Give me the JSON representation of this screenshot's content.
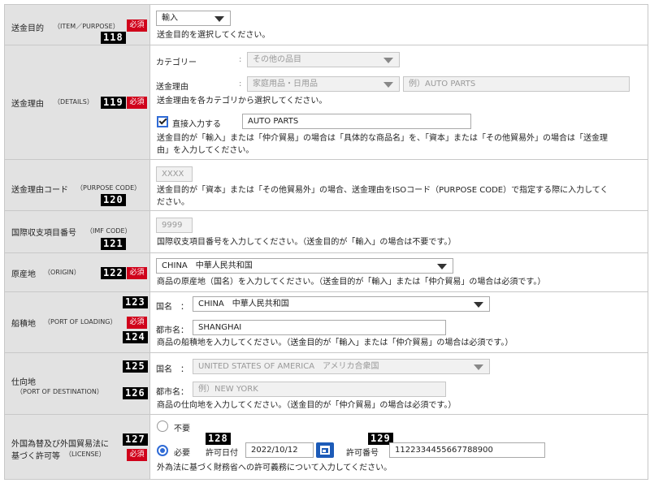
{
  "required_label": "必須",
  "rows": {
    "purpose": {
      "label": "送金目的",
      "label_en": "（ITEM／PURPOSE）",
      "number": "118",
      "value": "輸入",
      "help": "送金目的を選択してください。"
    },
    "details": {
      "label": "送金理由",
      "label_en": "（DETAILS）",
      "number": "119",
      "category_label": "カテゴリー",
      "category_value": "その他の品目",
      "reason_label": "送金理由",
      "reason_value": "家庭用品・日用品",
      "reason_placeholder": "例）AUTO PARTS",
      "help1": "送金理由を各カテゴリから選択してください。",
      "direct_label": "直接入力する",
      "direct_checked": true,
      "direct_value": "AUTO PARTS",
      "help2_line1": "送金目的が「輸入」または「仲介貿易」の場合は「具体的な商品名」を、「資本」または「その他貿易外」の場合は「送金理",
      "help2_line2": "由」を入力してください。"
    },
    "purpose_code": {
      "label": "送金理由コード",
      "label_en": "（PURPOSE CODE）",
      "number": "120",
      "placeholder": "XXXX",
      "help_line1": "送金目的が「資本」または「その他貿易外」の場合、送金理由をISOコード（PURPOSE CODE）で指定する際に入力してく",
      "help_line2": "ださい。"
    },
    "imf_code": {
      "label": "国際収支項目番号",
      "label_en": "（IMF CODE）",
      "number": "121",
      "placeholder": "9999",
      "help": "国際収支項目番号を入力してください。（送金目的が「輸入」の場合は不要です。）"
    },
    "origin": {
      "label": "原産地",
      "label_en": "（ORIGIN）",
      "number": "122",
      "value": "CHINA　中華人民共和国",
      "help": "商品の原産地（国名）を入力してください。（送金目的が「輸入」または「仲介貿易」の場合は必須です。）"
    },
    "loading": {
      "label": "船積地",
      "label_en": "（PORT OF LOADING）",
      "number_a": "123",
      "number_b": "124",
      "country_label": "国名　：",
      "country_value": "CHINA　中華人民共和国",
      "city_label": "都市名：",
      "city_value": "SHANGHAI",
      "help": "商品の船積地を入力してください。（送金目的が「輸入」または「仲介貿易」の場合は必須です。）"
    },
    "destination": {
      "label": "仕向地",
      "label_en": "（PORT OF DESTINATION）",
      "number_a": "125",
      "number_b": "126",
      "country_label": "国名　：",
      "country_value": "UNITED STATES OF AMERICA　アメリカ合衆国",
      "city_label": "都市名：",
      "city_placeholder": "例）NEW YORK",
      "help": "商品の仕向地を入力してください。（送金目的が「仲介貿易」の場合は必須です。）"
    },
    "license": {
      "label_line1": "外国為替及び外国貿易法に",
      "label_line2": "基づく許可等",
      "label_en": "（LICENSE）",
      "number_a": "127",
      "number_b": "128",
      "number_c": "129",
      "opt_not_required": "不要",
      "opt_required": "必要",
      "selected": "必要",
      "date_label": "許可日付",
      "date_value": "2022/10/12",
      "permit_label": "許可番号",
      "permit_value": "1122334455667788900",
      "help": "外為法に基づく財務省への許可義務について入力してください。"
    }
  }
}
